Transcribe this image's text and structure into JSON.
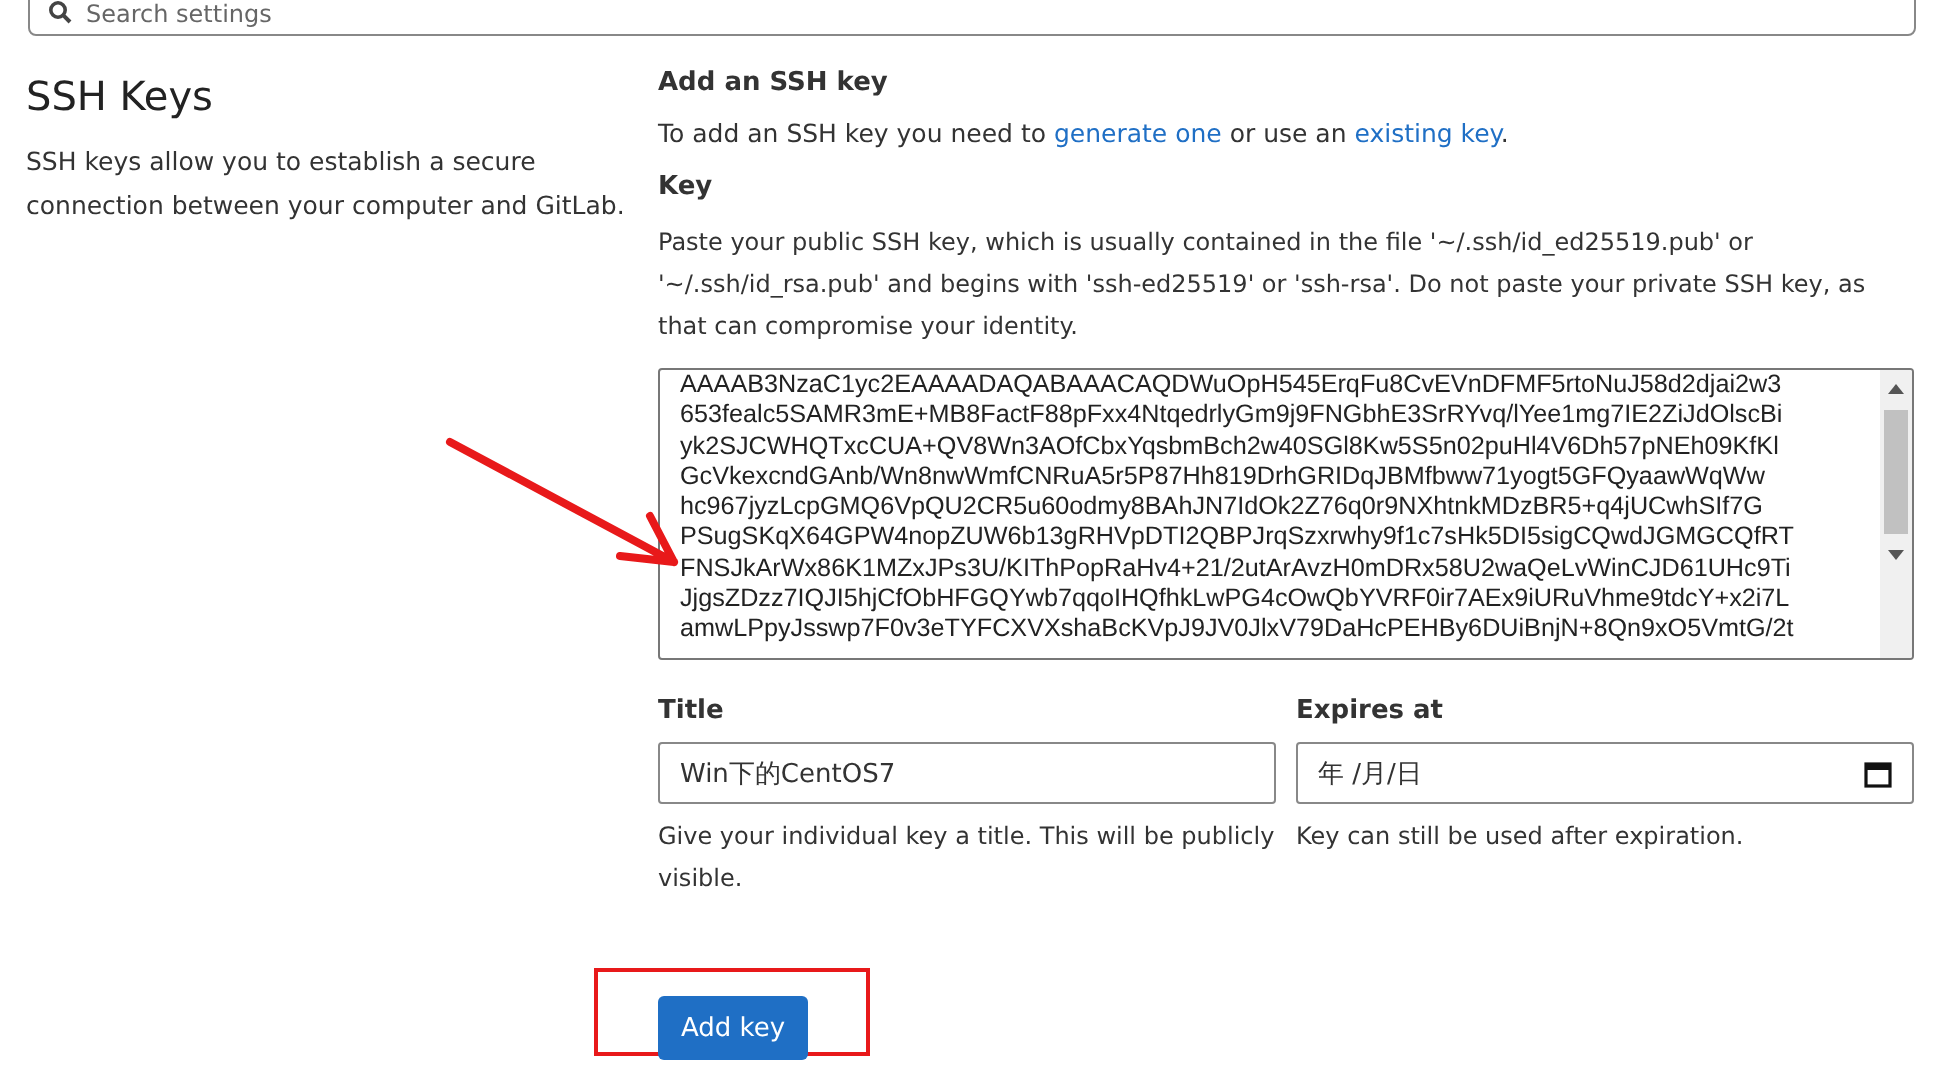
{
  "search": {
    "placeholder": "Search settings"
  },
  "section": {
    "title": "SSH Keys",
    "description": "SSH keys allow you to establish a secure connection between your computer and GitLab."
  },
  "form": {
    "heading": "Add an SSH key",
    "intro": [
      {
        "kind": "text",
        "text": "To add an SSH key you need to "
      },
      {
        "kind": "link",
        "text": "generate one"
      },
      {
        "kind": "text",
        "text": " or use an "
      },
      {
        "kind": "link",
        "text": "existing key"
      },
      {
        "kind": "text",
        "text": "."
      }
    ],
    "key_label": "Key",
    "key_help": "Paste your public SSH key, which is usually contained in the file '~/.ssh/id_ed25519.pub' or '~/.ssh/id_rsa.pub' and begins with 'ssh-ed25519' or 'ssh-rsa'. Do not paste your private SSH key, as that can compromise your identity.",
    "key_lines": [
      "AAAAB3NzaC1yc2EAAAADAQABAAACAQDWuOpH545ErqFu8CvEVnDFMF5rtoNuJ58d2djai2w3",
      "653fealc5SAMR3mE+MB8FactF88pFxx4NtqedrlyGm9j9FNGbhE3SrRYvq/lYee1mg7IE2ZiJdOlscBi",
      "yk2SJCWHQTxcCUA+QV8Wn3AOfCbxYqsbmBch2w40SGl8Kw5S5n02puHl4V6Dh57pNEh09KfKl",
      "GcVkexcndGAnb/Wn8nwWmfCNRuA5r5P87Hh819DrhGRIDqJBMfbww71yogt5GFQyaawWqWw",
      "hc967jyzLcpGMQ6VpQU2CR5u60odmy8BAhJN7IdOk2Z76q0r9NXhtnkMDzBR5+q4jUCwhSIf7G",
      "PSugSKqX64GPW4nopZUW6b13gRHVpDTI2QBPJrqSzxrwhy9f1c7sHk5DI5sigCQwdJGMGCQfRT",
      "FNSJkArWx86K1MZxJPs3U/KIThPopRaHv4+21/2utArAvzH0mDRx58U2waQeLvWinCJD61UHc9Ti",
      "JjgsZDzz7IQJI5hjCfObHFGQYwb7qqoIHQfhkLwPG4cOwQbYVRF0ir7AEx9iURuVhme9tdcY+x2i7L",
      "amwLPpyJsswp7F0v3eTYFCXVXshaBcKVpJ9JV0JlxV79DaHcPEHBy6DUiBnjN+8Qn9xO5VmtG/2t"
    ],
    "title_label": "Title",
    "title_value": "Win下的CentOS7",
    "title_help": "Give your individual key a title. This will be publicly visible.",
    "expires_label": "Expires at",
    "expires_value": "年 /月/日",
    "expires_help": "Key can still be used after expiration.",
    "submit": "Add key"
  }
}
